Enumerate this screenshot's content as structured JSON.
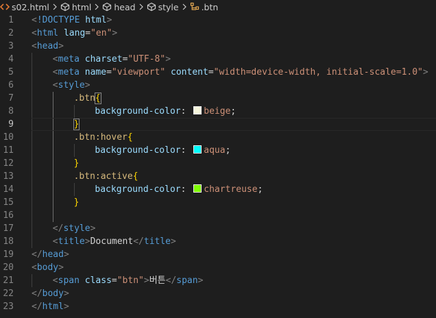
{
  "breadcrumb": {
    "items": [
      "s02.html",
      "html",
      "head",
      "style",
      ".btn"
    ]
  },
  "editor": {
    "lines": [
      {
        "n": "1",
        "indent": 0,
        "tokens": [
          [
            "punc",
            "<"
          ],
          [
            "tag",
            "!DOCTYPE"
          ],
          [
            "text",
            " "
          ],
          [
            "attr",
            "html"
          ],
          [
            "punc",
            ">"
          ]
        ]
      },
      {
        "n": "2",
        "indent": 0,
        "tokens": [
          [
            "punc",
            "<"
          ],
          [
            "tag",
            "html"
          ],
          [
            "text",
            " "
          ],
          [
            "attr",
            "lang"
          ],
          [
            "text",
            "="
          ],
          [
            "str",
            "\"en\""
          ],
          [
            "punc",
            ">"
          ]
        ]
      },
      {
        "n": "3",
        "indent": 0,
        "tokens": [
          [
            "punc",
            "<"
          ],
          [
            "tag",
            "head"
          ],
          [
            "punc",
            ">"
          ]
        ]
      },
      {
        "n": "4",
        "indent": 1,
        "tokens": [
          [
            "punc",
            "<"
          ],
          [
            "tag",
            "meta"
          ],
          [
            "text",
            " "
          ],
          [
            "attr",
            "charset"
          ],
          [
            "text",
            "="
          ],
          [
            "str",
            "\"UTF-8\""
          ],
          [
            "punc",
            ">"
          ]
        ]
      },
      {
        "n": "5",
        "indent": 1,
        "tokens": [
          [
            "punc",
            "<"
          ],
          [
            "tag",
            "meta"
          ],
          [
            "text",
            " "
          ],
          [
            "attr",
            "name"
          ],
          [
            "text",
            "="
          ],
          [
            "str",
            "\"viewport\""
          ],
          [
            "text",
            " "
          ],
          [
            "attr",
            "content"
          ],
          [
            "text",
            "="
          ],
          [
            "str",
            "\"width=device-width, initial-scale=1.0\""
          ],
          [
            "punc",
            ">"
          ]
        ]
      },
      {
        "n": "6",
        "indent": 1,
        "tokens": [
          [
            "punc",
            "<"
          ],
          [
            "tag",
            "style"
          ],
          [
            "punc",
            ">"
          ]
        ]
      },
      {
        "n": "7",
        "indent": 2,
        "tokens": [
          [
            "sel",
            ".btn"
          ],
          [
            "bracematch",
            "{"
          ]
        ]
      },
      {
        "n": "8",
        "indent": 3,
        "tokens": [
          [
            "prop",
            "background-color"
          ],
          [
            "text",
            ": "
          ],
          [
            "swatch",
            "#f5f5dc"
          ],
          [
            "val",
            "beige"
          ],
          [
            "text",
            ";"
          ]
        ]
      },
      {
        "n": "9",
        "indent": 2,
        "cursor": true,
        "tokens": [
          [
            "bracematch",
            "}"
          ]
        ]
      },
      {
        "n": "10",
        "indent": 2,
        "tokens": [
          [
            "sel",
            ".btn:hover"
          ],
          [
            "brace",
            "{"
          ]
        ]
      },
      {
        "n": "11",
        "indent": 3,
        "tokens": [
          [
            "prop",
            "background-color"
          ],
          [
            "text",
            ": "
          ],
          [
            "swatch",
            "#00ffff"
          ],
          [
            "val",
            "aqua"
          ],
          [
            "text",
            ";"
          ]
        ]
      },
      {
        "n": "12",
        "indent": 2,
        "tokens": [
          [
            "brace",
            "}"
          ]
        ]
      },
      {
        "n": "13",
        "indent": 2,
        "tokens": [
          [
            "sel",
            ".btn:active"
          ],
          [
            "brace",
            "{"
          ]
        ]
      },
      {
        "n": "14",
        "indent": 3,
        "tokens": [
          [
            "prop",
            "background-color"
          ],
          [
            "text",
            ": "
          ],
          [
            "swatch",
            "#7fff00"
          ],
          [
            "val",
            "chartreuse"
          ],
          [
            "text",
            ";"
          ]
        ]
      },
      {
        "n": "15",
        "indent": 2,
        "tokens": [
          [
            "brace",
            "}"
          ]
        ]
      },
      {
        "n": "16",
        "indent": 2,
        "tokens": []
      },
      {
        "n": "17",
        "indent": 1,
        "tokens": [
          [
            "punc",
            "</"
          ],
          [
            "tag",
            "style"
          ],
          [
            "punc",
            ">"
          ]
        ]
      },
      {
        "n": "18",
        "indent": 1,
        "tokens": [
          [
            "punc",
            "<"
          ],
          [
            "tag",
            "title"
          ],
          [
            "punc",
            ">"
          ],
          [
            "text",
            "Document"
          ],
          [
            "punc",
            "</"
          ],
          [
            "tag",
            "title"
          ],
          [
            "punc",
            ">"
          ]
        ]
      },
      {
        "n": "19",
        "indent": 0,
        "tokens": [
          [
            "punc",
            "</"
          ],
          [
            "tag",
            "head"
          ],
          [
            "punc",
            ">"
          ]
        ]
      },
      {
        "n": "20",
        "indent": 0,
        "tokens": [
          [
            "punc",
            "<"
          ],
          [
            "tag",
            "body"
          ],
          [
            "punc",
            ">"
          ]
        ]
      },
      {
        "n": "21",
        "indent": 1,
        "tokens": [
          [
            "punc",
            "<"
          ],
          [
            "tag",
            "span"
          ],
          [
            "text",
            " "
          ],
          [
            "attr",
            "class"
          ],
          [
            "text",
            "="
          ],
          [
            "str",
            "\"btn\""
          ],
          [
            "punc",
            ">"
          ],
          [
            "text",
            "버튼"
          ],
          [
            "punc",
            "</"
          ],
          [
            "tag",
            "span"
          ],
          [
            "punc",
            ">"
          ]
        ]
      },
      {
        "n": "22",
        "indent": 0,
        "tokens": [
          [
            "punc",
            "</"
          ],
          [
            "tag",
            "body"
          ],
          [
            "punc",
            ">"
          ]
        ]
      },
      {
        "n": "23",
        "indent": 0,
        "tokens": [
          [
            "punc",
            "</"
          ],
          [
            "tag",
            "html"
          ],
          [
            "punc",
            ">"
          ]
        ]
      }
    ]
  },
  "colors": {
    "background": "#1e1e1e",
    "tag": "#569cd6",
    "attribute": "#9cdcfe",
    "string": "#ce9178",
    "selector": "#d7ba7d",
    "brace": "#ffd700"
  },
  "icons": [
    "html-file-icon",
    "element-icon",
    "element-icon",
    "element-icon",
    "css-selector-icon"
  ]
}
